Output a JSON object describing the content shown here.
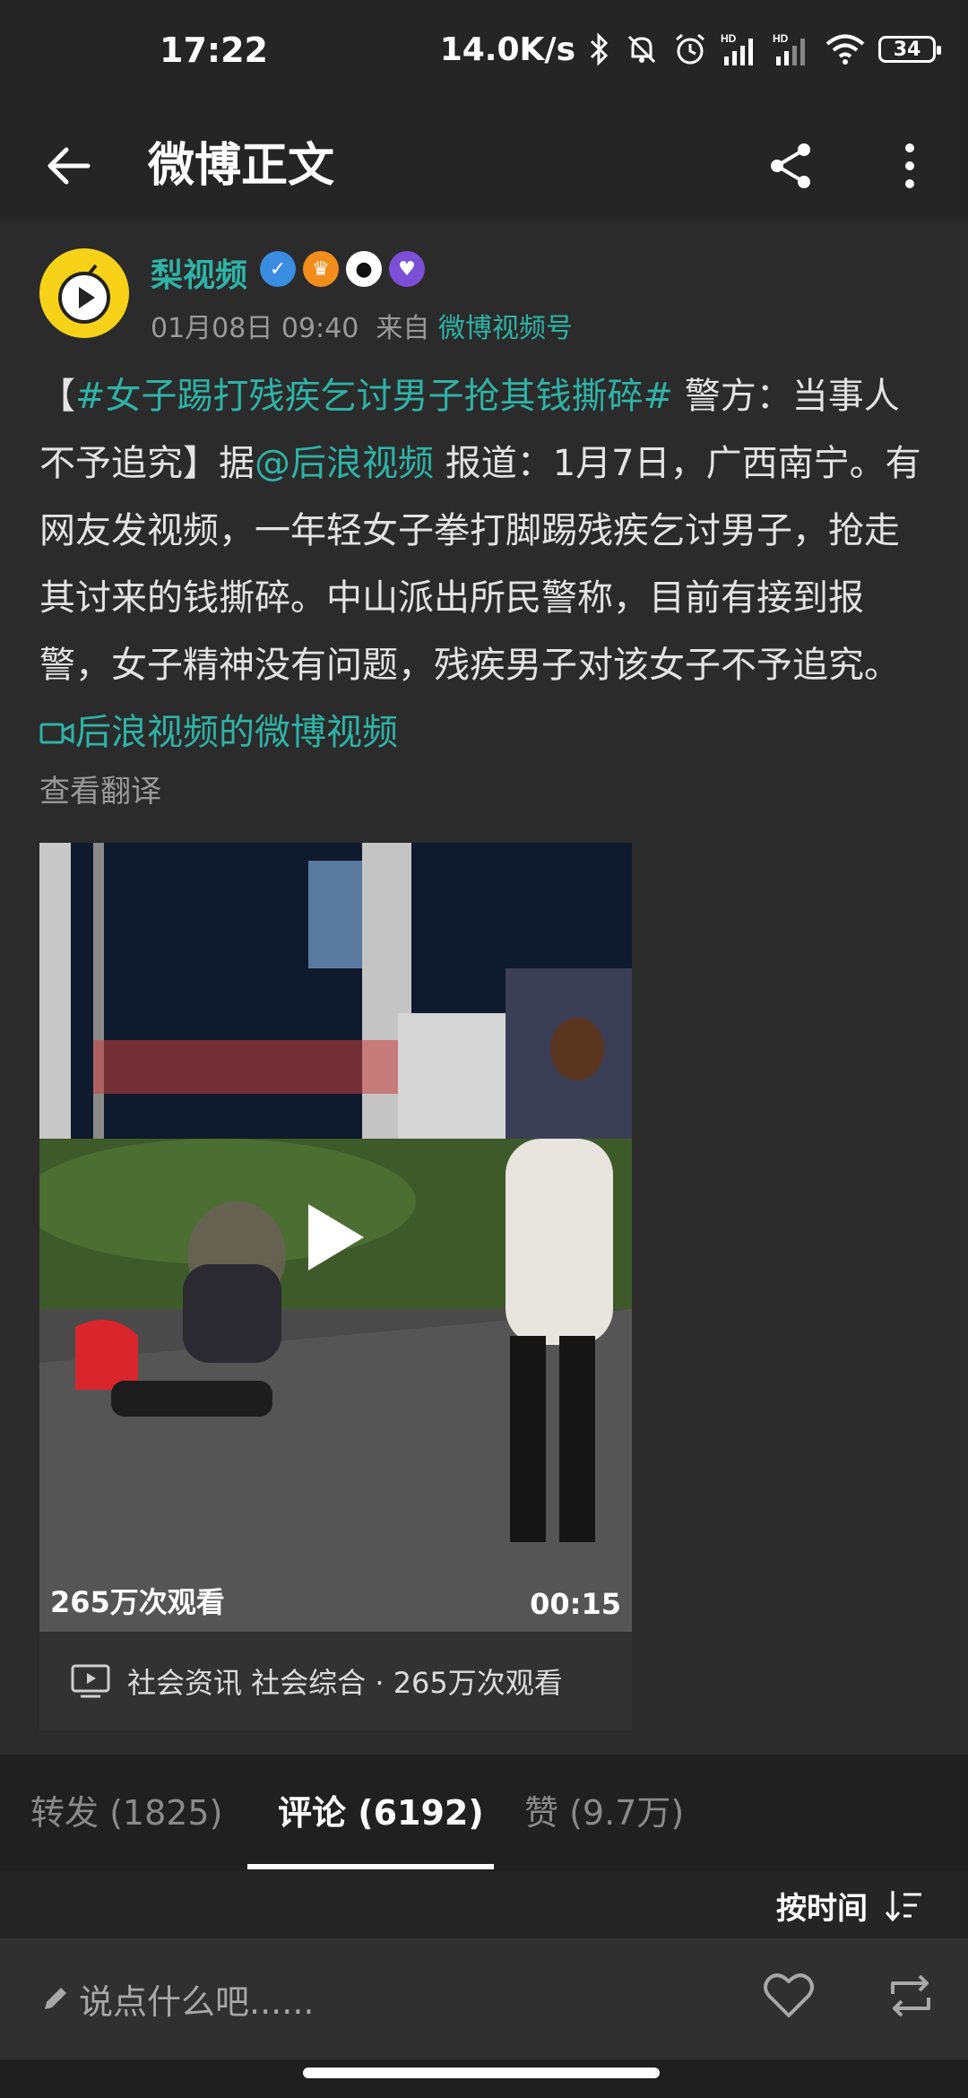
{
  "status_bar": {
    "time": "17:22",
    "speed": "14.0K/s",
    "battery": "34",
    "hd_label": "HD",
    "icons": [
      "bluetooth-icon",
      "mute-icon",
      "alarm-icon",
      "signal-icon",
      "signal-icon",
      "wifi-icon",
      "battery-icon"
    ]
  },
  "header": {
    "title": "微博正文",
    "back_icon": "back-arrow-icon",
    "share_icon": "share-icon",
    "more_icon": "more-vertical-icon"
  },
  "post": {
    "author": "梨视频",
    "date": "01月08日 09:40",
    "from_prefix": "来自",
    "source": "微博视频号",
    "text": {
      "open_bracket": "【",
      "hashtag": "#女子踢打残疾乞讨男子抢其钱撕碎#",
      "part1": " 警方：当事人不予追究】据",
      "mention": "@后浪视频",
      "part2": " 报道：1月7日，广西南宁。有网友发视频，一年轻女子拳打脚踢残疾乞讨男子，抢走其讨来的钱撕碎。中山派出所民警称，目前有接到报警，女子精神没有问题，残疾男子对该女子不予追究。 ",
      "video_link": "后浪视频的微博视频"
    },
    "translate": "查看翻译",
    "video": {
      "views": "265万次观看",
      "duration": "00:15",
      "info": "社会资讯 社会综合 · 265万次观看"
    }
  },
  "tabs": [
    {
      "label": "转发 (1825)",
      "active": false
    },
    {
      "label": "评论 (6192)",
      "active": true
    },
    {
      "label": "赞 (9.7万)",
      "active": false
    }
  ],
  "sort": {
    "label": "按时间"
  },
  "bottom": {
    "placeholder": "说点什么吧......"
  },
  "colors": {
    "accent": "#2eb3a6",
    "background": "#1f1f1f",
    "card": "#2b2b2b"
  }
}
